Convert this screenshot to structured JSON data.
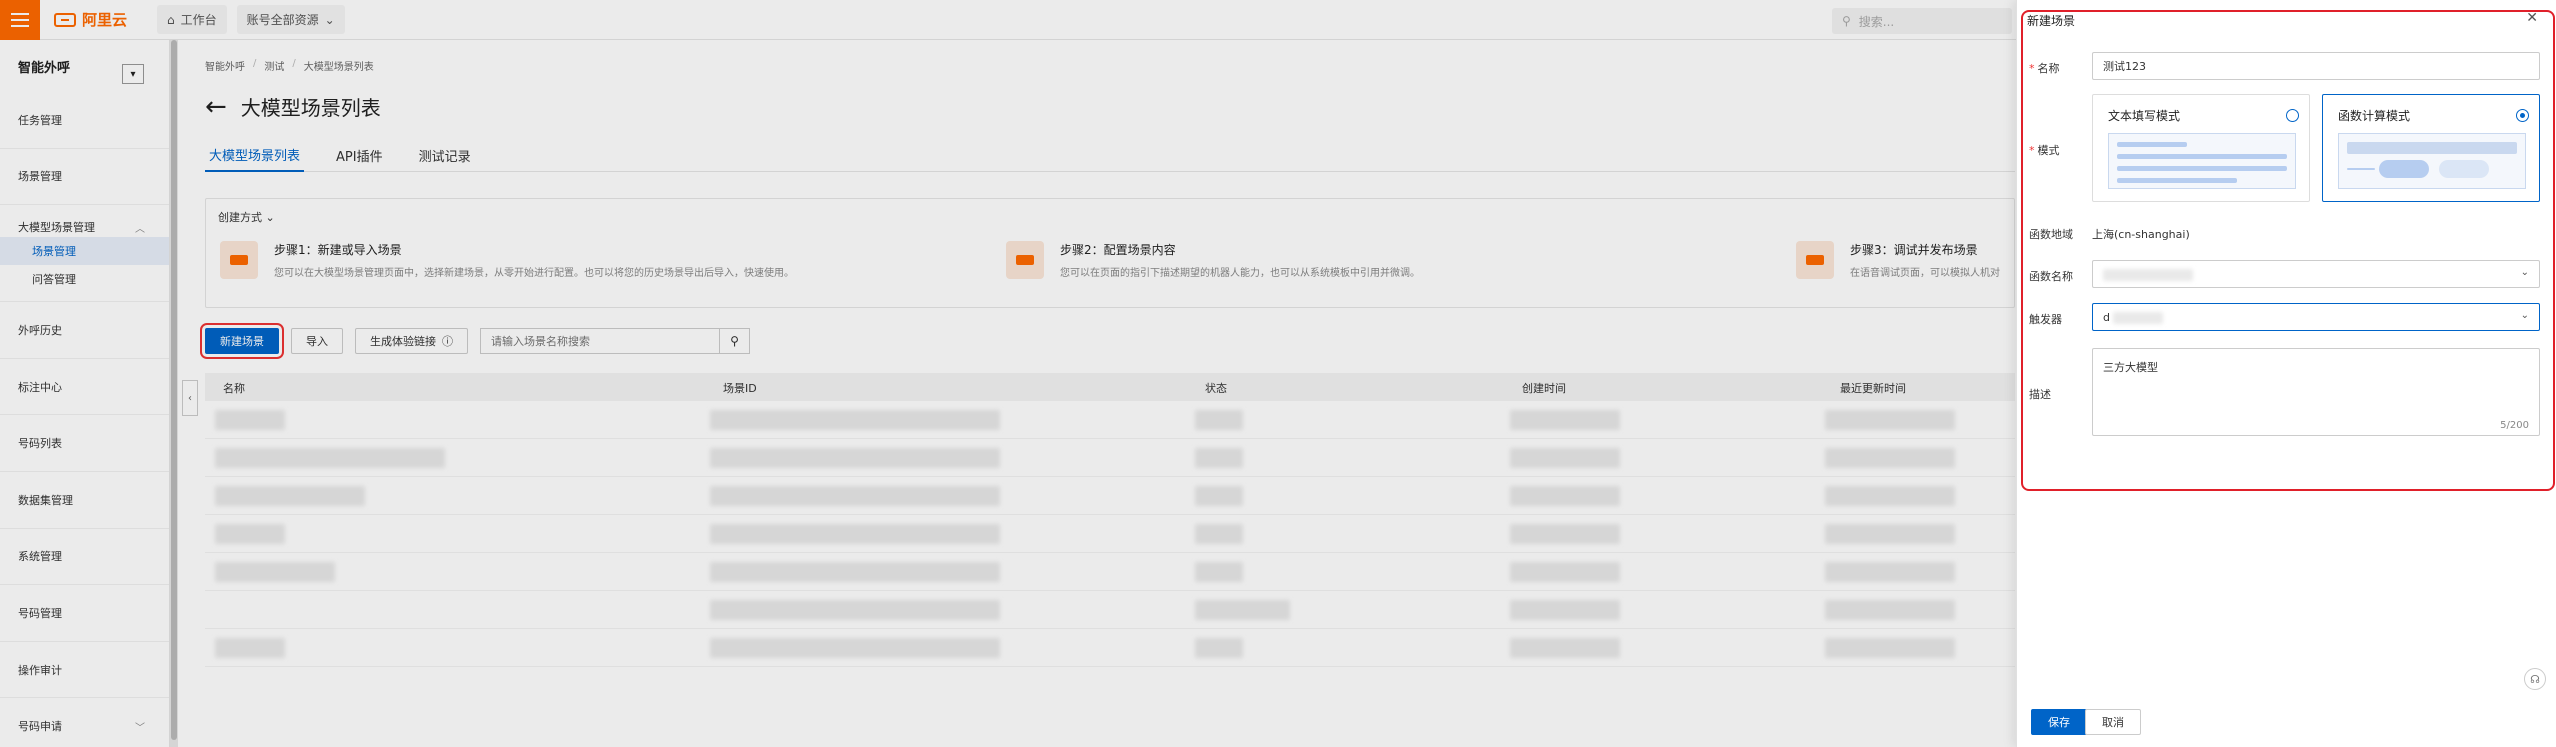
{
  "topbar": {
    "logo_text": "阿里云",
    "workbench": "工作台",
    "resources": "账号全部资源",
    "search_placeholder": "搜索..."
  },
  "sidebar": {
    "title": "智能外呼",
    "items": [
      {
        "label": "任务管理"
      },
      {
        "label": "场景管理"
      }
    ],
    "group": {
      "label": "大模型场景管理",
      "children": [
        {
          "label": "场景管理",
          "active": true
        },
        {
          "label": "问答管理"
        }
      ]
    },
    "items2": [
      {
        "label": "外呼历史"
      },
      {
        "label": "标注中心"
      },
      {
        "label": "号码列表"
      },
      {
        "label": "数据集管理"
      },
      {
        "label": "系统管理"
      },
      {
        "label": "号码管理"
      },
      {
        "label": "操作审计"
      },
      {
        "label": "号码申请"
      }
    ]
  },
  "main": {
    "breadcrumb": [
      "智能外呼",
      "测试",
      "大模型场景列表"
    ],
    "title": "大模型场景列表",
    "tabs": [
      {
        "label": "大模型场景列表",
        "active": true
      },
      {
        "label": "API插件"
      },
      {
        "label": "测试记录"
      }
    ],
    "create_label": "创建方式",
    "steps": [
      {
        "title": "步骤1：新建或导入场景",
        "desc": "您可以在大模型场景管理页面中，选择新建场景，从零开始进行配置。也可以将您的历史场景导出后导入，快速使用。"
      },
      {
        "title": "步骤2：配置场景内容",
        "desc": "您可以在页面的指引下描述期望的机器人能力，也可以从系统模板中引用并微调。"
      },
      {
        "title": "步骤3：调试并发布场景",
        "desc": "在语音调试页面，可以模拟人机对"
      }
    ],
    "toolbar": {
      "new_scene": "新建场景",
      "import": "导入",
      "gen_link": "生成体验链接",
      "search_placeholder": "请输入场景名称搜索"
    },
    "table_headers": [
      "名称",
      "场景ID",
      "状态",
      "创建时间",
      "最近更新时间"
    ]
  },
  "drawer": {
    "title": "新建场景",
    "name_label": "名称",
    "name_value": "测试123",
    "mode_label": "模式",
    "mode_text": "文本填写模式",
    "mode_func": "函数计算模式",
    "region_label": "函数地域",
    "region_value": "上海(cn-shanghai)",
    "func_name_label": "函数名称",
    "func_name_value": "",
    "trigger_label": "触发器",
    "trigger_value": "d",
    "desc_label": "描述",
    "desc_value": "三方大模型",
    "counter": "5/200",
    "save": "保存",
    "cancel": "取消"
  },
  "colors": {
    "brand": "#ff6a00",
    "primary": "#0064c8",
    "highlight": "#e0202a"
  }
}
